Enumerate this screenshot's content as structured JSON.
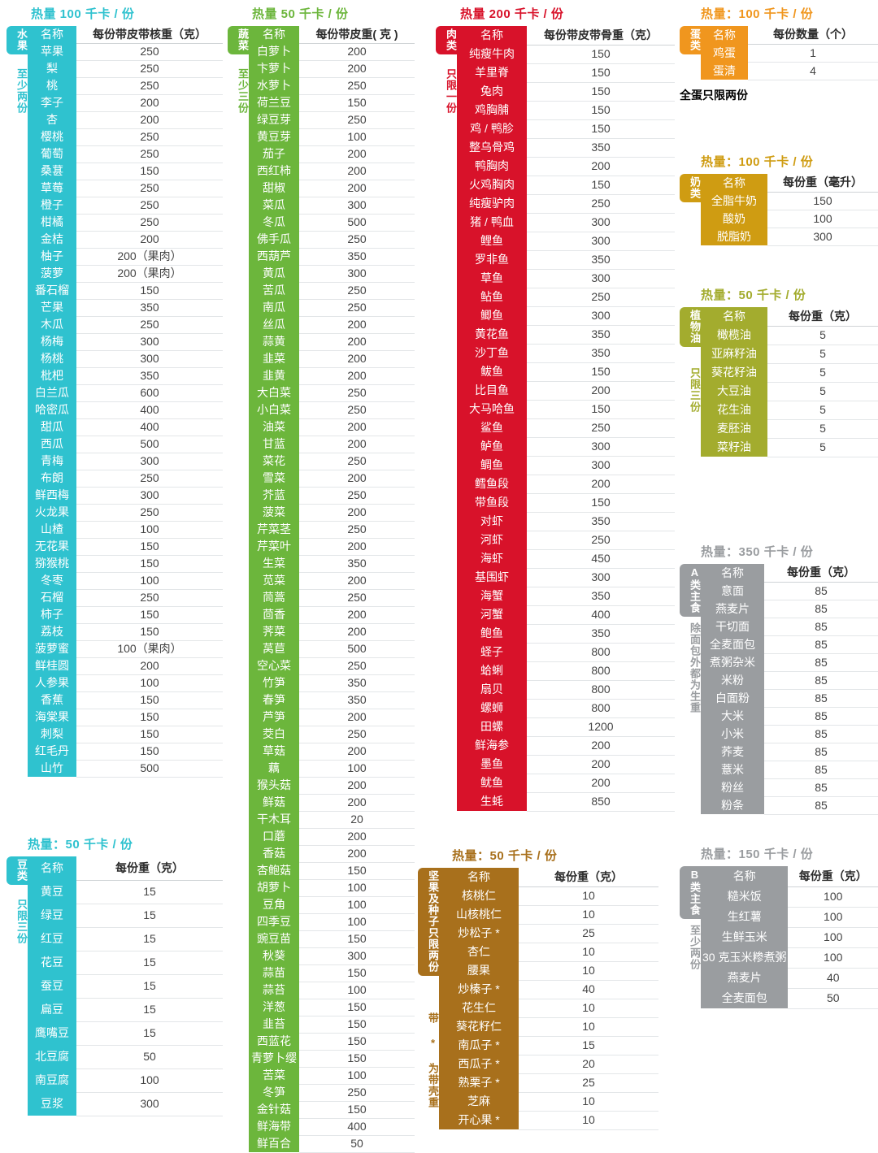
{
  "colors": {
    "fruit": "#2fc2cf",
    "vegetable": "#6cb63c",
    "meat": "#d8122a",
    "egg": "#f0961e",
    "milk": "#cf9c12",
    "oil": "#a3ac2e",
    "nut": "#a8701c",
    "grain": "#9a9da0"
  },
  "fruit": {
    "calorie_title": "热量 100 千卡 / 份",
    "tab_label": "水果",
    "tab_note": "至少两份",
    "header": {
      "name": "名称",
      "value": "每份带皮带核重（克）"
    },
    "rows": [
      {
        "name": "苹果",
        "value": "250"
      },
      {
        "name": "梨",
        "value": "250"
      },
      {
        "name": "桃",
        "value": "250"
      },
      {
        "name": "李子",
        "value": "200"
      },
      {
        "name": "杏",
        "value": "200"
      },
      {
        "name": "樱桃",
        "value": "250"
      },
      {
        "name": "葡萄",
        "value": "250"
      },
      {
        "name": "桑葚",
        "value": "150"
      },
      {
        "name": "草莓",
        "value": "250"
      },
      {
        "name": "橙子",
        "value": "250"
      },
      {
        "name": "柑橘",
        "value": "250"
      },
      {
        "name": "金桔",
        "value": "200"
      },
      {
        "name": "柚子",
        "value": "200（果肉）"
      },
      {
        "name": "菠萝",
        "value": "200（果肉）"
      },
      {
        "name": "番石榴",
        "value": "150"
      },
      {
        "name": "芒果",
        "value": "350"
      },
      {
        "name": "木瓜",
        "value": "250"
      },
      {
        "name": "杨梅",
        "value": "300"
      },
      {
        "name": "杨桃",
        "value": "300"
      },
      {
        "name": "枇杷",
        "value": "350"
      },
      {
        "name": "白兰瓜",
        "value": "600"
      },
      {
        "name": "哈密瓜",
        "value": "400"
      },
      {
        "name": "甜瓜",
        "value": "400"
      },
      {
        "name": "西瓜",
        "value": "500"
      },
      {
        "name": "青梅",
        "value": "300"
      },
      {
        "name": "布朗",
        "value": "250"
      },
      {
        "name": "鲜西梅",
        "value": "300"
      },
      {
        "name": "火龙果",
        "value": "250"
      },
      {
        "name": "山楂",
        "value": "100"
      },
      {
        "name": "无花果",
        "value": "150"
      },
      {
        "name": "猕猴桃",
        "value": "150"
      },
      {
        "name": "冬枣",
        "value": "100"
      },
      {
        "name": "石榴",
        "value": "250"
      },
      {
        "name": "柿子",
        "value": "150"
      },
      {
        "name": "荔枝",
        "value": "150"
      },
      {
        "name": "菠萝蜜",
        "value": "100（果肉）"
      },
      {
        "name": "鲜桂圆",
        "value": "200"
      },
      {
        "name": "人参果",
        "value": "100"
      },
      {
        "name": "香蕉",
        "value": "150"
      },
      {
        "name": "海棠果",
        "value": "150"
      },
      {
        "name": "刺梨",
        "value": "150"
      },
      {
        "name": "红毛丹",
        "value": "150"
      },
      {
        "name": "山竹",
        "value": "500"
      }
    ]
  },
  "bean": {
    "calorie_title": "热量：50 千卡 / 份",
    "tab_label": "豆类",
    "tab_note": "只限三份",
    "header": {
      "name": "名称",
      "value": "每份重（克）"
    },
    "rows": [
      {
        "name": "黄豆",
        "value": "15"
      },
      {
        "name": "绿豆",
        "value": "15"
      },
      {
        "name": "红豆",
        "value": "15"
      },
      {
        "name": "花豆",
        "value": "15"
      },
      {
        "name": "蚕豆",
        "value": "15"
      },
      {
        "name": "扁豆",
        "value": "15"
      },
      {
        "name": "鹰嘴豆",
        "value": "15"
      },
      {
        "name": "北豆腐",
        "value": "50"
      },
      {
        "name": "南豆腐",
        "value": "100"
      },
      {
        "name": "豆浆",
        "value": "300"
      }
    ]
  },
  "vegetable": {
    "calorie_title": "热量 50 千卡 / 份",
    "tab_label": "蔬菜",
    "tab_note": "至少三份",
    "header": {
      "name": "名称",
      "value": "每份带皮重( 克 )"
    },
    "rows": [
      {
        "name": "白萝卜",
        "value": "200"
      },
      {
        "name": "卞萝卜",
        "value": "200"
      },
      {
        "name": "水萝卜",
        "value": "250"
      },
      {
        "name": "荷兰豆",
        "value": "150"
      },
      {
        "name": "绿豆芽",
        "value": "250"
      },
      {
        "name": "黄豆芽",
        "value": "100"
      },
      {
        "name": "茄子",
        "value": "200"
      },
      {
        "name": "西红柿",
        "value": "200"
      },
      {
        "name": "甜椒",
        "value": "200"
      },
      {
        "name": "菜瓜",
        "value": "300"
      },
      {
        "name": "冬瓜",
        "value": "500"
      },
      {
        "name": "佛手瓜",
        "value": "250"
      },
      {
        "name": "西葫芦",
        "value": "350"
      },
      {
        "name": "黄瓜",
        "value": "300"
      },
      {
        "name": "苦瓜",
        "value": "250"
      },
      {
        "name": "南瓜",
        "value": "250"
      },
      {
        "name": "丝瓜",
        "value": "200"
      },
      {
        "name": "蒜黄",
        "value": "200"
      },
      {
        "name": "韭菜",
        "value": "200"
      },
      {
        "name": "韭黄",
        "value": "200"
      },
      {
        "name": "大白菜",
        "value": "250"
      },
      {
        "name": "小白菜",
        "value": "250"
      },
      {
        "name": "油菜",
        "value": "200"
      },
      {
        "name": "甘蓝",
        "value": "200"
      },
      {
        "name": "菜花",
        "value": "250"
      },
      {
        "name": "雪菜",
        "value": "200"
      },
      {
        "name": "芥蓝",
        "value": "250"
      },
      {
        "name": "菠菜",
        "value": "200"
      },
      {
        "name": "芹菜茎",
        "value": "250"
      },
      {
        "name": "芹菜叶",
        "value": "200"
      },
      {
        "name": "生菜",
        "value": "350"
      },
      {
        "name": "苋菜",
        "value": "200"
      },
      {
        "name": "茼蒿",
        "value": "250"
      },
      {
        "name": "茴香",
        "value": "200"
      },
      {
        "name": "荠菜",
        "value": "200"
      },
      {
        "name": "莴苣",
        "value": "500"
      },
      {
        "name": "空心菜",
        "value": "250"
      },
      {
        "name": "竹笋",
        "value": "350"
      },
      {
        "name": "春笋",
        "value": "350"
      },
      {
        "name": "芦笋",
        "value": "200"
      },
      {
        "name": "茭白",
        "value": "250"
      },
      {
        "name": "草菇",
        "value": "200"
      },
      {
        "name": "藕",
        "value": "100"
      },
      {
        "name": "猴头菇",
        "value": "200"
      },
      {
        "name": "鲜菇",
        "value": "200"
      },
      {
        "name": "干木耳",
        "value": "20"
      },
      {
        "name": "口蘑",
        "value": "200"
      },
      {
        "name": "香菇",
        "value": "200"
      },
      {
        "name": "杏鲍菇",
        "value": "150"
      },
      {
        "name": "胡萝卜",
        "value": "100"
      },
      {
        "name": "豆角",
        "value": "100"
      },
      {
        "name": "四季豆",
        "value": "100"
      },
      {
        "name": "豌豆苗",
        "value": "150"
      },
      {
        "name": "秋葵",
        "value": "300"
      },
      {
        "name": "蒜苗",
        "value": "150"
      },
      {
        "name": "蒜苔",
        "value": "100"
      },
      {
        "name": "洋葱",
        "value": "150"
      },
      {
        "name": "韭苔",
        "value": "150"
      },
      {
        "name": "西蓝花",
        "value": "150"
      },
      {
        "name": "青萝卜缨",
        "value": "150"
      },
      {
        "name": "苦菜",
        "value": "100"
      },
      {
        "name": "冬笋",
        "value": "250"
      },
      {
        "name": "金针菇",
        "value": "150"
      },
      {
        "name": "鲜海带",
        "value": "400"
      },
      {
        "name": "鲜百合",
        "value": "50"
      }
    ]
  },
  "meat": {
    "calorie_title": "热量 200 千卡 / 份",
    "tab_label": "肉类",
    "tab_note": "只限一份",
    "header": {
      "name": "名称",
      "value": "每份带皮带骨重（克）"
    },
    "rows": [
      {
        "name": "纯瘦牛肉",
        "value": "150"
      },
      {
        "name": "羊里脊",
        "value": "150"
      },
      {
        "name": "兔肉",
        "value": "150"
      },
      {
        "name": "鸡胸脯",
        "value": "150"
      },
      {
        "name": "鸡 / 鸭胗",
        "value": "150"
      },
      {
        "name": "整乌骨鸡",
        "value": "350"
      },
      {
        "name": "鸭胸肉",
        "value": "200"
      },
      {
        "name": "火鸡胸肉",
        "value": "150"
      },
      {
        "name": "纯瘦驴肉",
        "value": "250"
      },
      {
        "name": "猪 / 鸭血",
        "value": "300"
      },
      {
        "name": "鲤鱼",
        "value": "300"
      },
      {
        "name": "罗非鱼",
        "value": "350"
      },
      {
        "name": "草鱼",
        "value": "300"
      },
      {
        "name": "鲇鱼",
        "value": "250"
      },
      {
        "name": "鲫鱼",
        "value": "300"
      },
      {
        "name": "黄花鱼",
        "value": "350"
      },
      {
        "name": "沙丁鱼",
        "value": "350"
      },
      {
        "name": "鲅鱼",
        "value": "150"
      },
      {
        "name": "比目鱼",
        "value": "200"
      },
      {
        "name": "大马哈鱼",
        "value": "150"
      },
      {
        "name": "鲨鱼",
        "value": "250"
      },
      {
        "name": "鲈鱼",
        "value": "300"
      },
      {
        "name": "鲷鱼",
        "value": "300"
      },
      {
        "name": "鳕鱼段",
        "value": "200"
      },
      {
        "name": "带鱼段",
        "value": "150"
      },
      {
        "name": "对虾",
        "value": "350"
      },
      {
        "name": "河虾",
        "value": "250"
      },
      {
        "name": "海虾",
        "value": "450"
      },
      {
        "name": "基围虾",
        "value": "300"
      },
      {
        "name": "海蟹",
        "value": "350"
      },
      {
        "name": "河蟹",
        "value": "400"
      },
      {
        "name": "鲍鱼",
        "value": "350"
      },
      {
        "name": "蛏子",
        "value": "800"
      },
      {
        "name": "蛤蜊",
        "value": "800"
      },
      {
        "name": "扇贝",
        "value": "800"
      },
      {
        "name": "螺蛳",
        "value": "800"
      },
      {
        "name": "田螺",
        "value": "1200"
      },
      {
        "name": "鲜海参",
        "value": "200"
      },
      {
        "name": "墨鱼",
        "value": "200"
      },
      {
        "name": "鱿鱼",
        "value": "200"
      },
      {
        "name": "生蚝",
        "value": "850"
      }
    ]
  },
  "nut": {
    "calorie_title": "热量：50 千卡 / 份",
    "tab_label": "坚果及种子只限两份",
    "tab_note": "带 * 为带壳重",
    "header": {
      "name": "名称",
      "value": "每份重（克）"
    },
    "rows": [
      {
        "name": "核桃仁",
        "value": "10"
      },
      {
        "name": "山核桃仁",
        "value": "10"
      },
      {
        "name": "炒松子 *",
        "value": "25"
      },
      {
        "name": "杏仁",
        "value": "10"
      },
      {
        "name": "腰果",
        "value": "10"
      },
      {
        "name": "炒榛子 *",
        "value": "40"
      },
      {
        "name": "花生仁",
        "value": "10"
      },
      {
        "name": "葵花籽仁",
        "value": "10"
      },
      {
        "name": "南瓜子 *",
        "value": "15"
      },
      {
        "name": "西瓜子 *",
        "value": "20"
      },
      {
        "name": "熟栗子 *",
        "value": "25"
      },
      {
        "name": "芝麻",
        "value": "10"
      },
      {
        "name": "开心果 *",
        "value": "10"
      }
    ]
  },
  "egg": {
    "calorie_title": "热量：100 千卡 / 份",
    "tab_label": "蛋类",
    "tab_note": "",
    "header": {
      "name": "名称",
      "value": "每份数量（个）"
    },
    "rows": [
      {
        "name": "鸡蛋",
        "value": "1"
      },
      {
        "name": "蛋清",
        "value": "4"
      }
    ],
    "footnote": "全蛋只限两份"
  },
  "milk": {
    "calorie_title": "热量：100 千卡 / 份",
    "tab_label": "奶类",
    "tab_note": "",
    "header": {
      "name": "名称",
      "value": "每份重（毫升）"
    },
    "rows": [
      {
        "name": "全脂牛奶",
        "value": "150"
      },
      {
        "name": "酸奶",
        "value": "100"
      },
      {
        "name": "脱脂奶",
        "value": "300"
      }
    ]
  },
  "oil": {
    "calorie_title": "热量：50 千卡 / 份",
    "tab_label": "植物油",
    "tab_note": "只限三份",
    "header": {
      "name": "名称",
      "value": "每份重（克）"
    },
    "rows": [
      {
        "name": "橄榄油",
        "value": "5"
      },
      {
        "name": "亚麻籽油",
        "value": "5"
      },
      {
        "name": "葵花籽油",
        "value": "5"
      },
      {
        "name": "大豆油",
        "value": "5"
      },
      {
        "name": "花生油",
        "value": "5"
      },
      {
        "name": "麦胚油",
        "value": "5"
      },
      {
        "name": "菜籽油",
        "value": "5"
      }
    ]
  },
  "grainA": {
    "calorie_title": "热量：350 千卡 / 份",
    "tab_label": "A类主食",
    "tab_note": "除面包外都为生重",
    "header": {
      "name": "名称",
      "value": "每份重（克）"
    },
    "rows": [
      {
        "name": "意面",
        "value": "85"
      },
      {
        "name": "燕麦片",
        "value": "85"
      },
      {
        "name": "干切面",
        "value": "85"
      },
      {
        "name": "全麦面包",
        "value": "85"
      },
      {
        "name": "煮粥杂米",
        "value": "85"
      },
      {
        "name": "米粉",
        "value": "85"
      },
      {
        "name": "白面粉",
        "value": "85"
      },
      {
        "name": "大米",
        "value": "85"
      },
      {
        "name": "小米",
        "value": "85"
      },
      {
        "name": "荞麦",
        "value": "85"
      },
      {
        "name": "薏米",
        "value": "85"
      },
      {
        "name": "粉丝",
        "value": "85"
      },
      {
        "name": "粉条",
        "value": "85"
      }
    ]
  },
  "grainB": {
    "calorie_title": "热量：150 千卡 / 份",
    "tab_label": "B类主食",
    "tab_note": "至少两份",
    "header": {
      "name": "名称",
      "value": "每份重（克）"
    },
    "rows": [
      {
        "name": "糙米饭",
        "value": "100"
      },
      {
        "name": "生红薯",
        "value": "100"
      },
      {
        "name": "生鲜玉米",
        "value": "100"
      },
      {
        "name": "30 克玉米糁煮粥",
        "value": "100"
      },
      {
        "name": "燕麦片",
        "value": "40"
      },
      {
        "name": "全麦面包",
        "value": "50"
      }
    ]
  }
}
